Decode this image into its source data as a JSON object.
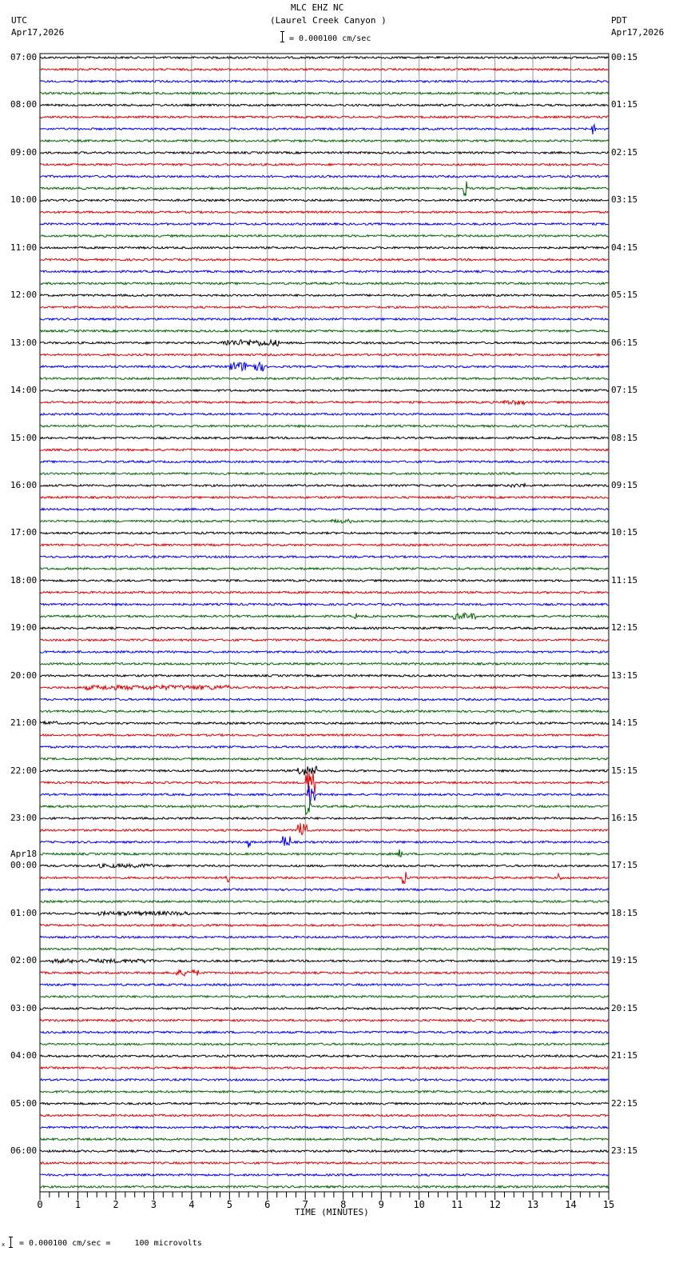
{
  "header": {
    "station": "MLC EHZ NC",
    "location": "(Laurel Creek Canyon )",
    "left_tz": "UTC",
    "left_date": "Apr17,2026",
    "right_tz": "PDT",
    "right_date": "Apr17,2026",
    "scale_text": "= 0.000100 cm/sec"
  },
  "footer": {
    "scale_text": "= 0.000100 cm/sec =     100 microvolts",
    "scale_prefix": "x"
  },
  "colors": [
    "#000000",
    "#dd0000",
    "#0000ee",
    "#006600"
  ],
  "chart_data": {
    "type": "line",
    "title": "MLC EHZ NC (Laurel Creek Canyon )",
    "xlabel": "TIME (MINUTES)",
    "xlim": [
      0,
      15
    ],
    "x_ticks": [
      "0",
      "1",
      "2",
      "3",
      "4",
      "5",
      "6",
      "7",
      "8",
      "9",
      "10",
      "11",
      "12",
      "13",
      "14",
      "15"
    ],
    "traces_per_hour": 4,
    "left_labels": [
      "07:00",
      "08:00",
      "09:00",
      "10:00",
      "11:00",
      "12:00",
      "13:00",
      "14:00",
      "15:00",
      "16:00",
      "17:00",
      "18:00",
      "19:00",
      "20:00",
      "21:00",
      "22:00",
      "23:00",
      "00:00",
      "01:00",
      "02:00",
      "03:00",
      "04:00",
      "05:00",
      "06:00"
    ],
    "date_change_label": "Apr18",
    "date_change_hour_index": 17,
    "right_labels": [
      "00:15",
      "01:15",
      "02:15",
      "03:15",
      "04:15",
      "05:15",
      "06:15",
      "07:15",
      "08:15",
      "09:15",
      "10:15",
      "11:15",
      "12:15",
      "13:15",
      "14:15",
      "15:15",
      "16:15",
      "17:15",
      "18:15",
      "19:15",
      "20:15",
      "21:15",
      "22:15",
      "23:15"
    ],
    "events": [
      {
        "row": 6,
        "start": 14.55,
        "end": 14.65,
        "amp": 7
      },
      {
        "row": 11,
        "start": 11.15,
        "end": 11.25,
        "amp": 10
      },
      {
        "row": 24,
        "start": 4.8,
        "end": 6.3,
        "amp": 4
      },
      {
        "row": 26,
        "start": 5.0,
        "end": 5.9,
        "amp": 6
      },
      {
        "row": 29,
        "start": 12.2,
        "end": 12.8,
        "amp": 3
      },
      {
        "row": 36,
        "start": 12.4,
        "end": 12.8,
        "amp": 2.5
      },
      {
        "row": 39,
        "start": 7.7,
        "end": 8.2,
        "amp": 2.5
      },
      {
        "row": 47,
        "start": 10.9,
        "end": 11.5,
        "amp": 4
      },
      {
        "row": 47,
        "start": 8.3,
        "end": 8.35,
        "amp": 4
      },
      {
        "row": 53,
        "start": 1.2,
        "end": 5.0,
        "amp": 3
      },
      {
        "row": 56,
        "start": 0.0,
        "end": 0.5,
        "amp": 2.5
      },
      {
        "row": 60,
        "start": 6.8,
        "end": 7.3,
        "amp": 6
      },
      {
        "row": 61,
        "start": 7.0,
        "end": 7.25,
        "amp": 18
      },
      {
        "row": 62,
        "start": 7.05,
        "end": 7.25,
        "amp": 14
      },
      {
        "row": 63,
        "start": 7.0,
        "end": 7.15,
        "amp": 10
      },
      {
        "row": 65,
        "start": 6.8,
        "end": 7.05,
        "amp": 14
      },
      {
        "row": 66,
        "start": 5.45,
        "end": 5.55,
        "amp": 8
      },
      {
        "row": 66,
        "start": 6.4,
        "end": 6.6,
        "amp": 8
      },
      {
        "row": 67,
        "start": 9.45,
        "end": 9.55,
        "amp": 7
      },
      {
        "row": 68,
        "start": 1.5,
        "end": 3.0,
        "amp": 2.5
      },
      {
        "row": 69,
        "start": 4.9,
        "end": 5.0,
        "amp": 9
      },
      {
        "row": 69,
        "start": 9.55,
        "end": 9.65,
        "amp": 8
      },
      {
        "row": 69,
        "start": 13.65,
        "end": 13.75,
        "amp": 6
      },
      {
        "row": 72,
        "start": 1.5,
        "end": 4.0,
        "amp": 2.5
      },
      {
        "row": 76,
        "start": 0.3,
        "end": 3.0,
        "amp": 2.5
      },
      {
        "row": 77,
        "start": 3.5,
        "end": 4.2,
        "amp": 4
      }
    ]
  }
}
